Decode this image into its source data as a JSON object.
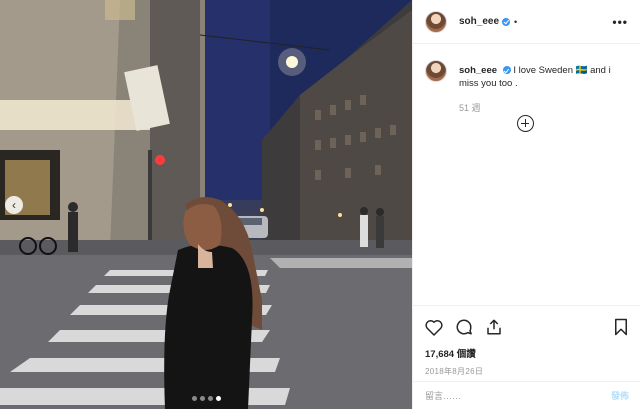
{
  "post": {
    "username": "soh_eee",
    "separator": "•",
    "more_label": "•••"
  },
  "caption": {
    "username": "soh_eee",
    "text": "I love Sweden 🇸🇪 and i miss you too .",
    "time": "51 週"
  },
  "stats": {
    "likes": "17,684 個讚",
    "date": "2018年8月26日"
  },
  "comment_box": {
    "placeholder": "留言……",
    "post_label": "發佈"
  },
  "carousel": {
    "prev_label": "‹",
    "dot_count": 4,
    "active_index": 3
  },
  "icons": [
    "heart-icon",
    "comment-icon",
    "share-icon",
    "bookmark-icon",
    "add-icon",
    "verified-icon"
  ],
  "colors": {
    "verified": "#3897f0",
    "muted": "#999999",
    "post_button": "#b2dffc",
    "sky": "#1c2450"
  }
}
